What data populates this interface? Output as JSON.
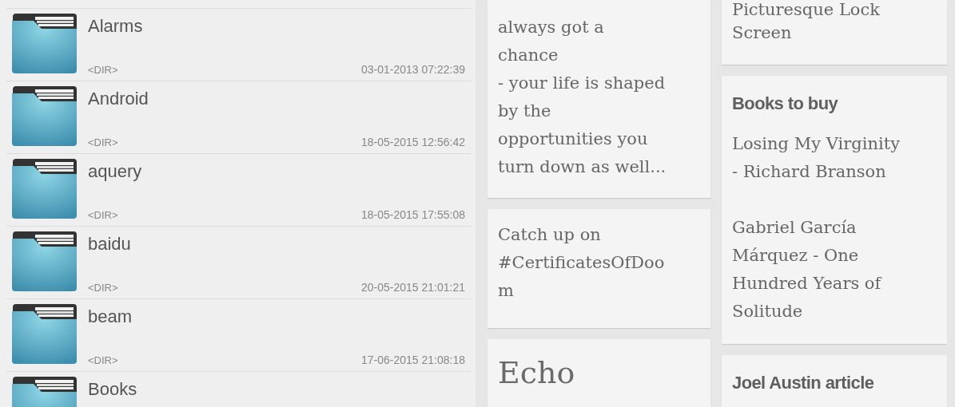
{
  "files": [
    {
      "name": "Alarms",
      "type": "<DIR>",
      "modified": "03-01-2013 07:22:39"
    },
    {
      "name": "Android",
      "type": "<DIR>",
      "modified": "18-05-2015 12:56:42"
    },
    {
      "name": "aquery",
      "type": "<DIR>",
      "modified": "18-05-2015 17:55:08"
    },
    {
      "name": "baidu",
      "type": "<DIR>",
      "modified": "20-05-2015 21:01:21"
    },
    {
      "name": "beam",
      "type": "<DIR>",
      "modified": "17-06-2015 21:08:18"
    },
    {
      "name": "Books"
    }
  ],
  "notes": {
    "columns": [
      [
        {
          "kind": "plain",
          "paragraphs": [
            [
              "always got a",
              "chance",
              "- your life is shaped",
              "by the",
              "opportunities you",
              "turn down as well..."
            ]
          ]
        },
        {
          "kind": "plain",
          "paragraphs": [
            [
              "Catch up on",
              "#CertificatesOfDoo",
              "m"
            ]
          ]
        },
        {
          "kind": "large_title",
          "title": "Echo"
        }
      ],
      [
        {
          "kind": "plain",
          "paragraphs": [
            [
              "Picturesque Lock",
              "Screen"
            ]
          ]
        },
        {
          "kind": "bold_title",
          "title": "Books to buy",
          "paragraphs": [
            [
              "Losing My Virginity",
              "- Richard Branson"
            ],
            [
              "Gabriel García",
              "Márquez - One",
              "Hundred Years of",
              "Solitude"
            ]
          ]
        },
        {
          "kind": "bold_title",
          "title": "Joel Austin article"
        }
      ]
    ]
  }
}
